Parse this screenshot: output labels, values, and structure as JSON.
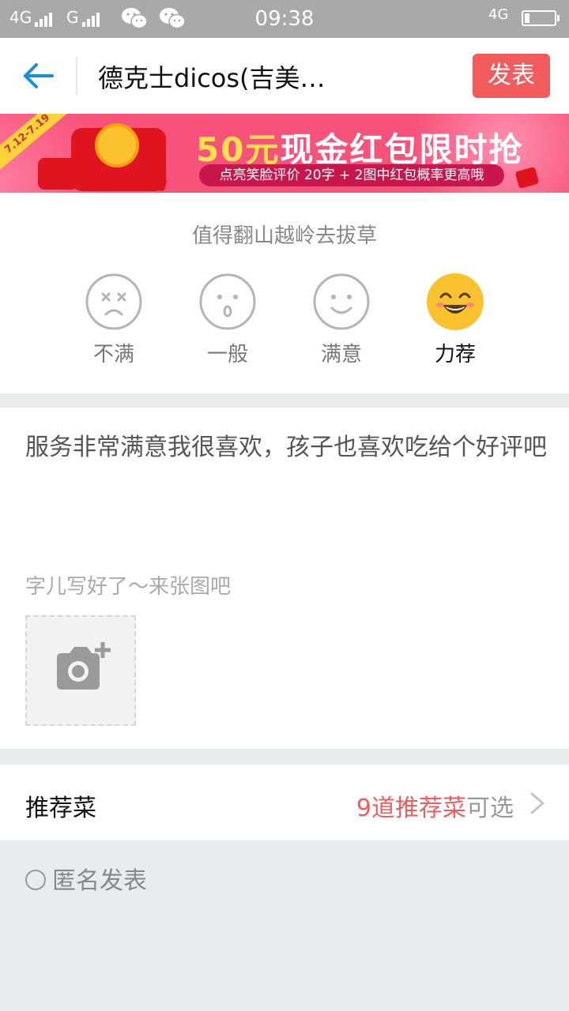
{
  "status_bar": {
    "network_1": "4G",
    "network_2": "G",
    "time": "09:38",
    "network_right": "4G",
    "icons": [
      "signal-icon",
      "wechat-icon",
      "battery-icon"
    ]
  },
  "header": {
    "title": "德克士dicos(吉美…",
    "publish_label": "发表",
    "back_icon": "arrow-left-icon"
  },
  "banner": {
    "date_tag": "7.12-7.19",
    "headline_highlight": "50元",
    "headline_rest": "现金红包限时抢",
    "subline": "点亮笑脸评价 20字 + 2图中红包概率更高哦"
  },
  "rating": {
    "hint": "值得翻山越岭去拔草",
    "options": [
      {
        "label": "不满",
        "icon": "dissatisfied-face-icon"
      },
      {
        "label": "一般",
        "icon": "neutral-face-icon"
      },
      {
        "label": "满意",
        "icon": "satisfied-face-icon"
      },
      {
        "label": "力荐",
        "icon": "recommend-face-icon"
      }
    ],
    "selected_index": 3
  },
  "review": {
    "text": "服务非常满意我很喜欢，孩子也喜欢吃给个好评吧",
    "photo_prompt": "字儿写好了～来张图吧"
  },
  "dishes": {
    "label": "推荐菜",
    "count_highlight": "9道推荐菜",
    "count_suffix": "可选"
  },
  "anonymous": {
    "label": "匿名发表"
  },
  "colors": {
    "accent_red": "#f25c5c",
    "link_blue": "#1a8ce0",
    "star_yellow": "#f9c22e"
  }
}
